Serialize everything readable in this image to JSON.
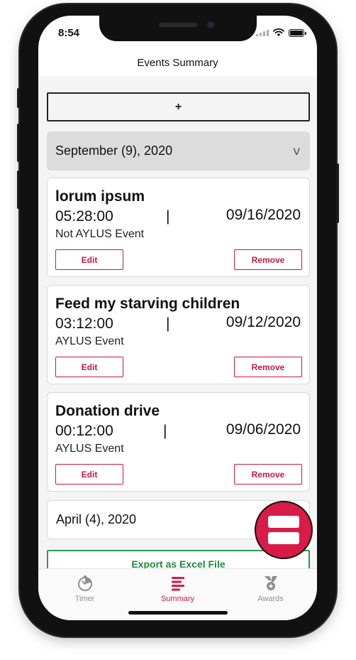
{
  "status_bar": {
    "time": "8:54"
  },
  "nav": {
    "title": "Events Summary"
  },
  "add_button": {
    "label": "+"
  },
  "months": [
    {
      "label": "September (9), 2020",
      "chevron": "V"
    },
    {
      "label": "April (4), 2020"
    }
  ],
  "events": [
    {
      "name": "lorum ipsum",
      "duration": "05:28:00",
      "separator": "|",
      "date": "09/16/2020",
      "type": "Not AYLUS Event",
      "edit_label": "Edit",
      "remove_label": "Remove"
    },
    {
      "name": "Feed my starving children",
      "duration": "03:12:00",
      "separator": "|",
      "date": "09/12/2020",
      "type": "AYLUS Event",
      "edit_label": "Edit",
      "remove_label": "Remove"
    },
    {
      "name": "Donation drive",
      "duration": "00:12:00",
      "separator": "|",
      "date": "09/06/2020",
      "type": "AYLUS Event",
      "edit_label": "Edit",
      "remove_label": "Remove"
    }
  ],
  "export": {
    "label": "Export as Excel File"
  },
  "tabs": [
    {
      "label": "Timer",
      "icon": "timer-icon",
      "active": false
    },
    {
      "label": "Summary",
      "icon": "list-icon",
      "active": true
    },
    {
      "label": "Awards",
      "icon": "award-icon",
      "active": false
    }
  ],
  "colors": {
    "accent": "#d81b47",
    "export_green": "#1f8a3e",
    "inactive_tab": "#8e8e8e"
  }
}
